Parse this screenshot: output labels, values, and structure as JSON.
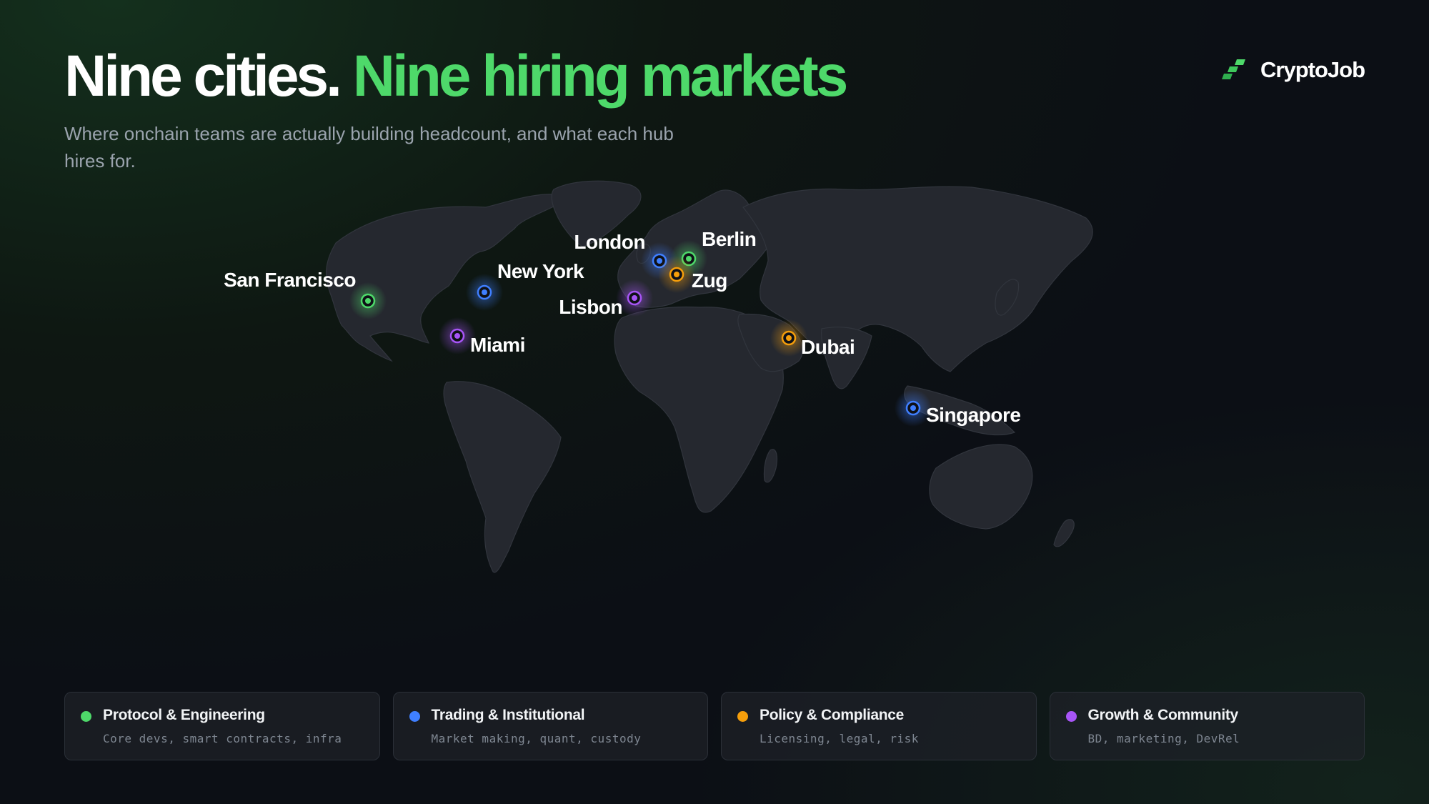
{
  "header": {
    "title_part1": "Nine cities.",
    "title_part2": "Nine hiring markets",
    "subtitle": "Where onchain teams are actually building headcount, and what each hub hires for."
  },
  "brand": {
    "name": "CryptoJob",
    "icon": "cryptojob-logo-icon"
  },
  "colors": {
    "protocol": "#4ed96a",
    "trading": "#3f7fff",
    "policy": "#f59e0b",
    "growth": "#a855f7",
    "land": "#252830",
    "accent": "#4ed96a"
  },
  "cities": [
    {
      "name": "San Francisco",
      "category": "protocol"
    },
    {
      "name": "New York",
      "category": "trading"
    },
    {
      "name": "Miami",
      "category": "growth"
    },
    {
      "name": "London",
      "category": "trading"
    },
    {
      "name": "Berlin",
      "category": "protocol"
    },
    {
      "name": "Zug",
      "category": "policy"
    },
    {
      "name": "Lisbon",
      "category": "growth"
    },
    {
      "name": "Dubai",
      "category": "policy"
    },
    {
      "name": "Singapore",
      "category": "trading"
    }
  ],
  "legend": [
    {
      "key": "protocol",
      "title": "Protocol & Engineering",
      "desc": "Core devs, smart contracts, infra"
    },
    {
      "key": "trading",
      "title": "Trading & Institutional",
      "desc": "Market making, quant, custody"
    },
    {
      "key": "policy",
      "title": "Policy & Compliance",
      "desc": "Licensing, legal, risk"
    },
    {
      "key": "growth",
      "title": "Growth & Community",
      "desc": "BD, marketing, DevRel"
    }
  ]
}
